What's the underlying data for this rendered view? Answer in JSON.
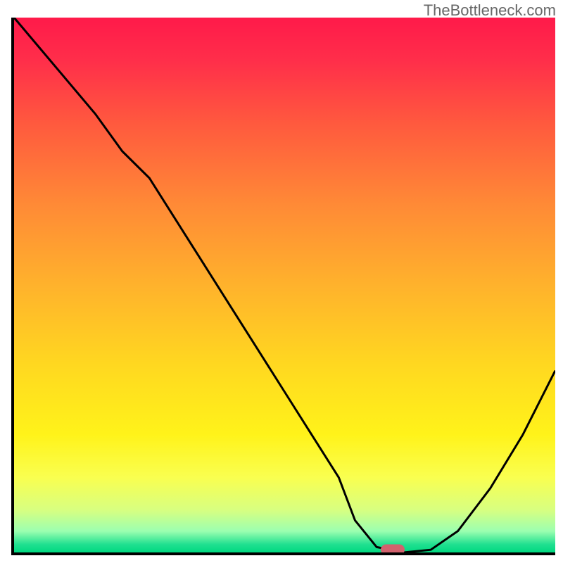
{
  "watermark": "TheBottleneck.com",
  "chart_data": {
    "type": "line",
    "title": "",
    "xlabel": "",
    "ylabel": "",
    "xlim": [
      0,
      100
    ],
    "ylim": [
      0,
      100
    ],
    "x": [
      0,
      5,
      10,
      15,
      20,
      25,
      30,
      35,
      40,
      45,
      50,
      55,
      60,
      63,
      67,
      72,
      77,
      82,
      88,
      94,
      100
    ],
    "values": [
      100,
      94,
      88,
      82,
      75,
      70,
      62,
      54,
      46,
      38,
      30,
      22,
      14,
      6,
      1,
      0,
      0.5,
      4,
      12,
      22,
      34
    ],
    "gradient_stops": [
      {
        "pos": 0.0,
        "color": "#ff1a4a"
      },
      {
        "pos": 0.08,
        "color": "#ff2e4a"
      },
      {
        "pos": 0.2,
        "color": "#ff5a3e"
      },
      {
        "pos": 0.35,
        "color": "#ff8a36"
      },
      {
        "pos": 0.5,
        "color": "#ffb22c"
      },
      {
        "pos": 0.65,
        "color": "#ffd820"
      },
      {
        "pos": 0.78,
        "color": "#fff31a"
      },
      {
        "pos": 0.86,
        "color": "#f9ff50"
      },
      {
        "pos": 0.92,
        "color": "#d8ff80"
      },
      {
        "pos": 0.96,
        "color": "#9cffb0"
      },
      {
        "pos": 0.985,
        "color": "#20e090"
      },
      {
        "pos": 1.0,
        "color": "#00d880"
      }
    ],
    "marker": {
      "x": 70,
      "y": 0.5,
      "color": "#d2616d"
    }
  }
}
